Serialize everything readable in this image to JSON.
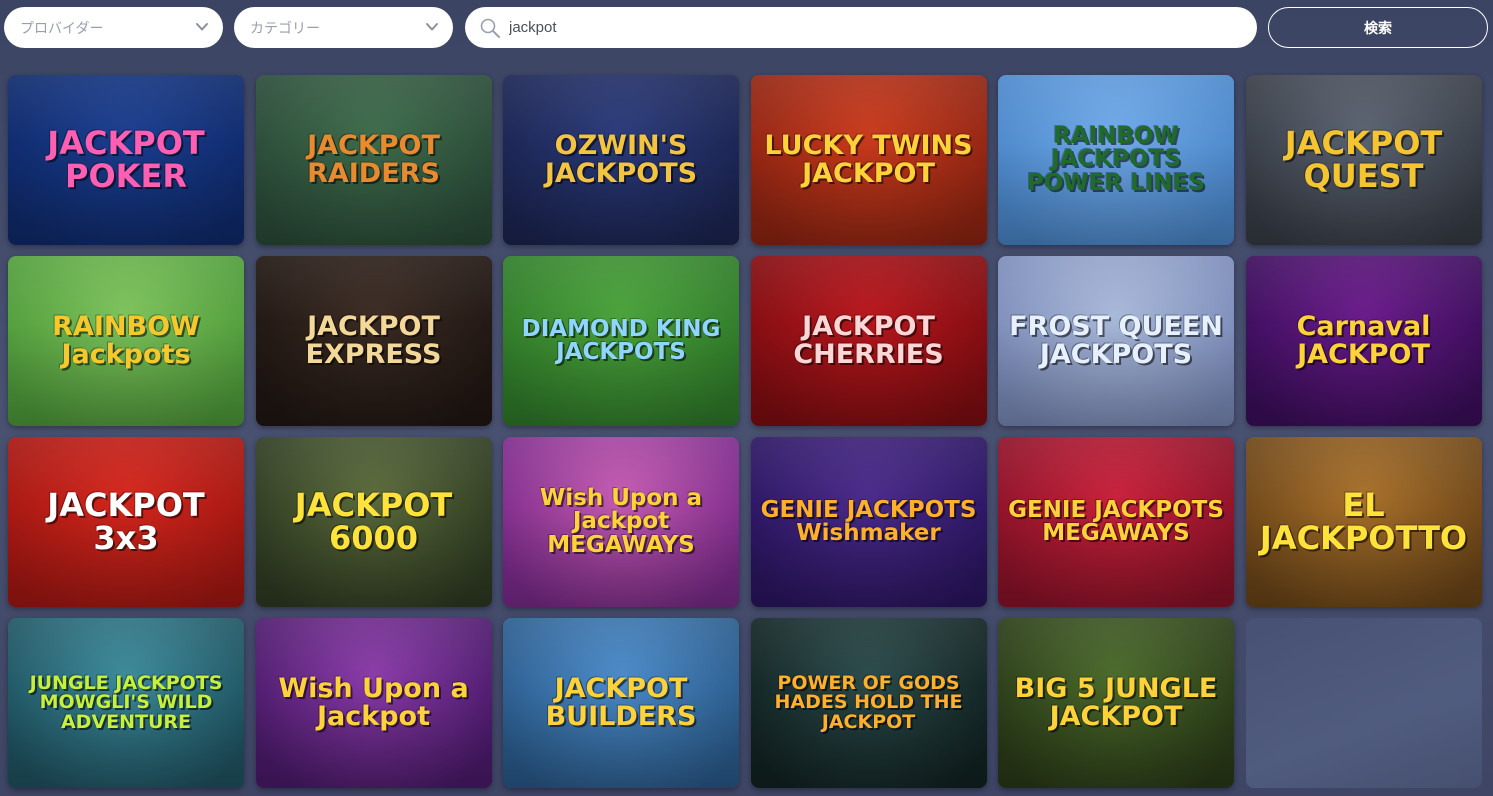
{
  "filters": {
    "provider_placeholder": "プロバイダー",
    "category_placeholder": "カテゴリー"
  },
  "search": {
    "value": "jackpot"
  },
  "search_button": "検索",
  "games": [
    {
      "title": "JACKPOT POKER",
      "bg": [
        "#1a3d8f",
        "#0f2a6b"
      ],
      "fg": "#ff5fb3"
    },
    {
      "title": "JACKPOT RAIDERS",
      "bg": [
        "#3d6b4a",
        "#2a4a38"
      ],
      "fg": "#e98a2e"
    },
    {
      "title": "OZWIN'S JACKPOTS",
      "bg": [
        "#2a3a7a",
        "#1b2450"
      ],
      "fg": "#f2c440"
    },
    {
      "title": "LUCKY TWINS JACKPOT",
      "bg": [
        "#c93a1c",
        "#8e2412"
      ],
      "fg": "#ffd23a"
    },
    {
      "title": "RAINBOW JACKPOTS POWER LINES",
      "bg": [
        "#6fa9e8",
        "#4a86c9"
      ],
      "fg": "#1f6b2a"
    },
    {
      "title": "JACKPOT QUEST",
      "bg": [
        "#5a6270",
        "#363b44"
      ],
      "fg": "#f4c531"
    },
    {
      "title": "RAINBOW Jackpots",
      "bg": [
        "#7cc25a",
        "#4e9a3a"
      ],
      "fg": "#f5c92d"
    },
    {
      "title": "JACKPOT EXPRESS",
      "bg": [
        "#3a2a22",
        "#1f1612"
      ],
      "fg": "#f3d89a"
    },
    {
      "title": "DIAMOND KING JACKPOTS",
      "bg": [
        "#4aa23a",
        "#2f7a2a"
      ],
      "fg": "#8fd6ff"
    },
    {
      "title": "JACKPOT CHERRIES",
      "bg": [
        "#b8161c",
        "#7e0d11"
      ],
      "fg": "#ffd6d6"
    },
    {
      "title": "FROST QUEEN JACKPOTS",
      "bg": [
        "#a8b8d8",
        "#7a8ab8"
      ],
      "fg": "#e6f0ff"
    },
    {
      "title": "Carnaval JACKPOT",
      "bg": [
        "#6a1a8a",
        "#3a0e5a"
      ],
      "fg": "#ffd23a"
    },
    {
      "title": "JACKPOT 3x3",
      "bg": [
        "#d4261c",
        "#a31712"
      ],
      "fg": "#ffffff"
    },
    {
      "title": "JACKPOT 6000",
      "bg": [
        "#5a6a3a",
        "#2e3a22"
      ],
      "fg": "#ffe23a"
    },
    {
      "title": "Wish Upon a Jackpot MEGAWAYS",
      "bg": [
        "#c45ab0",
        "#7a2a8a"
      ],
      "fg": "#ffd23a"
    },
    {
      "title": "GENIE JACKPOTS Wishmaker",
      "bg": [
        "#4a2a8a",
        "#2a1560"
      ],
      "fg": "#ffb02a"
    },
    {
      "title": "GENIE JACKPOTS MEGAWAYS",
      "bg": [
        "#c8203a",
        "#8a1228"
      ],
      "fg": "#ffd23a"
    },
    {
      "title": "EL JACKPOTTO",
      "bg": [
        "#a8702a",
        "#6a4418"
      ],
      "fg": "#ffe23a"
    },
    {
      "title": "JUNGLE JACKPOTS MOWGLI'S WILD ADVENTURE",
      "bg": [
        "#3a8a9a",
        "#1f5260"
      ],
      "fg": "#c6f03a"
    },
    {
      "title": "Wish Upon a Jackpot",
      "bg": [
        "#8a3aa8",
        "#4a1a6a"
      ],
      "fg": "#ffd23a"
    },
    {
      "title": "JACKPOT BUILDERS",
      "bg": [
        "#4a8ac8",
        "#2a5a8a"
      ],
      "fg": "#ffd23a"
    },
    {
      "title": "POWER OF GODS HADES HOLD THE JACKPOT",
      "bg": [
        "#2a4a4a",
        "#122222"
      ],
      "fg": "#ffb02a"
    },
    {
      "title": "BIG 5 JUNGLE JACKPOT",
      "bg": [
        "#4a6a2a",
        "#2a3a18"
      ],
      "fg": "#ffd23a"
    }
  ]
}
